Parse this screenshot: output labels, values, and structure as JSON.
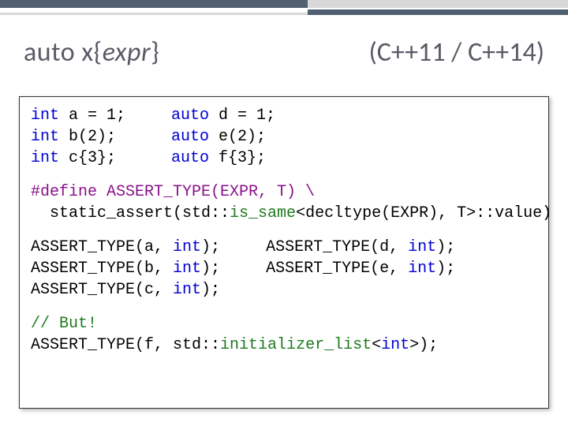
{
  "heading": {
    "left_auto": "auto x{",
    "left_expr": "expr",
    "left_close": "}",
    "right": "(C++11 / C++14)"
  },
  "code": {
    "decl_left": [
      {
        "kw": "int",
        "rest": " a = 1;"
      },
      {
        "kw": "int",
        "rest": " b(2);"
      },
      {
        "kw": "int",
        "rest": " c{3};"
      }
    ],
    "decl_right": [
      {
        "kw": "auto",
        "rest": " d = 1;"
      },
      {
        "kw": "auto",
        "rest": " e(2);"
      },
      {
        "kw": "auto",
        "rest": " f{3};"
      }
    ],
    "define_line1_macro": "#define ASSERT_TYPE(EXPR, T) \\",
    "define_line2_pre": "  static_assert(std::",
    "define_line2_tmpl": "is_same",
    "define_line2_post": "<decltype(EXPR), T>::value)",
    "asserts_left": [
      {
        "pre": "ASSERT_TYPE(a, ",
        "kw": "int",
        "post": ");"
      },
      {
        "pre": "ASSERT_TYPE(b, ",
        "kw": "int",
        "post": ");"
      },
      {
        "pre": "ASSERT_TYPE(c, ",
        "kw": "int",
        "post": ");"
      }
    ],
    "asserts_right": [
      {
        "pre": "ASSERT_TYPE(d, ",
        "kw": "int",
        "post": ");"
      },
      {
        "pre": "ASSERT_TYPE(e, ",
        "kw": "int",
        "post": ");"
      }
    ],
    "but_comment": "// But!",
    "f_assert_pre": "ASSERT_TYPE(f, std::",
    "f_assert_tmpl": "initializer_list",
    "f_assert_mid": "<",
    "f_assert_kw": "int",
    "f_assert_post": ">);"
  }
}
